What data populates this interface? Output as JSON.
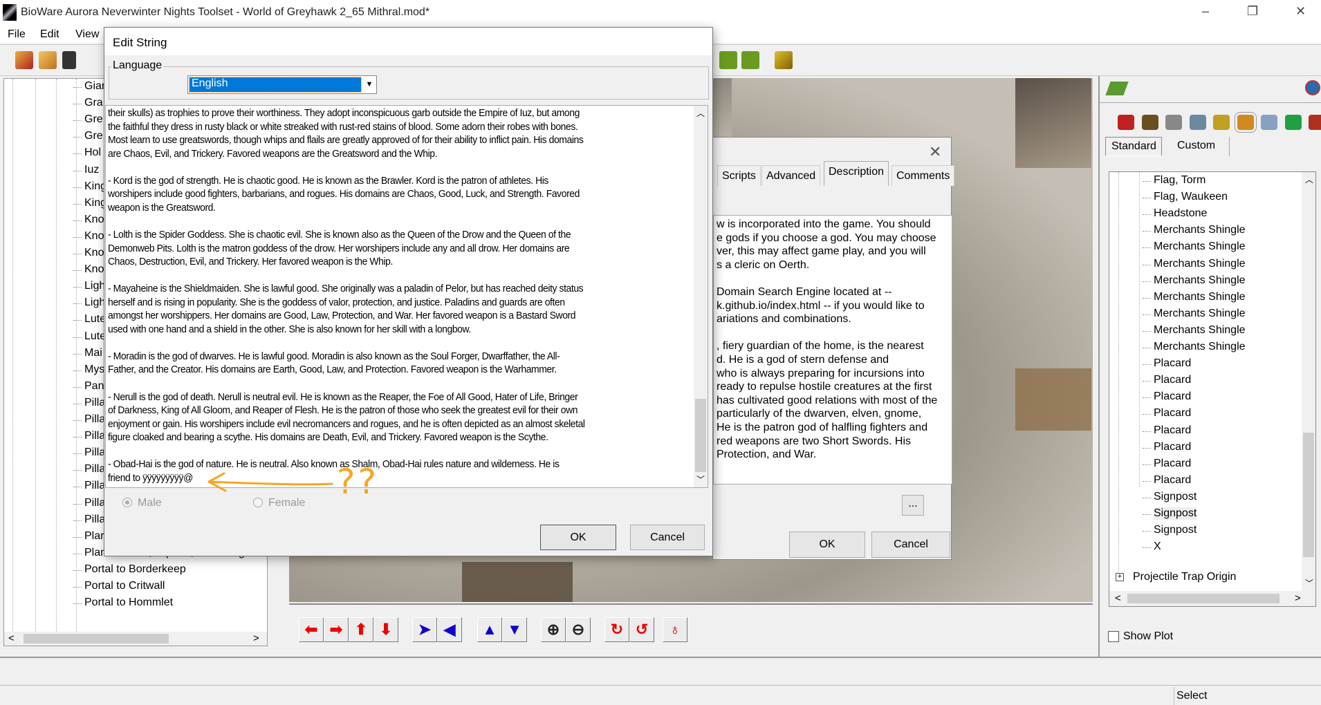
{
  "window": {
    "title": "BioWare Aurora Neverwinter Nights Toolset - World of Greyhawk 2_65 Mithral.mod*",
    "minimize": "–",
    "maximize": "❐",
    "close": "✕"
  },
  "menu": [
    "File",
    "Edit",
    "View"
  ],
  "left_tree": [
    "Giar",
    "Gra",
    "Gre",
    "Gre",
    "Hol",
    "Iuz",
    "King",
    "King",
    "Kno",
    "Kno",
    "Kno",
    "Kno",
    "Ligh",
    "Ligh",
    "Lute",
    "Lute",
    "Mai",
    "Mys",
    "Pan",
    "Pilla",
    "Pilla",
    "Pilla",
    "Pilla",
    "Pilla",
    "Pilla",
    "Pilla",
    "Pilla",
    "Plar",
    "Plant in Vase, Square, Flowering",
    "Portal to Borderkeep",
    "Portal to Critwall",
    "Portal to Hommlet"
  ],
  "nav_toolbar": {
    "icons": [
      "pan-left-icon",
      "pan-right-icon",
      "pan-up-icon",
      "pan-down-icon",
      "rotate-right-icon",
      "rotate-left-icon",
      "tilt-up-icon",
      "tilt-down-icon",
      "zoom-in-icon",
      "zoom-out-icon",
      "rotate-cw-icon",
      "rotate-ccw-icon",
      "reset-camera-icon"
    ],
    "glyphs": [
      "⬅",
      "➡",
      "⬆",
      "⬇",
      "➤",
      "◀",
      "▲",
      "▼",
      "⊕",
      "⊖",
      "↻",
      "↺",
      "♁"
    ]
  },
  "status": {
    "mode": "Select"
  },
  "right_panel": {
    "palette_tabs": [
      "Standard",
      "Custom"
    ],
    "tree": [
      "Flag, Torm",
      "Flag, Waukeen",
      "Headstone",
      "Merchants Shingle",
      "Merchants Shingle",
      "Merchants Shingle",
      "Merchants Shingle",
      "Merchants Shingle",
      "Merchants Shingle",
      "Merchants Shingle",
      "Merchants Shingle",
      "Placard",
      "Placard",
      "Placard",
      "Placard",
      "Placard",
      "Placard",
      "Placard",
      "Placard",
      "Signpost",
      "Signpost",
      "Signpost",
      "X"
    ],
    "tree_group": "Projectile Trap Origin",
    "show_plot": "Show Plot"
  },
  "properties_dialog": {
    "tabs": [
      "Scripts",
      "Advanced",
      "Description",
      "Comments"
    ],
    "active_tab": "Description",
    "close": "✕",
    "text_lines": [
      "w is incorporated into the game.  You should",
      "e gods if you choose a god.  You may choose",
      "ver, this may affect game play, and you will",
      "s a cleric on Oerth.",
      "",
      "Domain Search Engine located at --",
      "k.github.io/index.html -- if you would like to",
      "ariations and combinations.",
      "",
      ", fiery guardian of the home, is the nearest",
      "d.  He is a god of stern defense and",
      "who is always preparing for incursions into",
      "ready to repulse hostile creatures at the first",
      "has cultivated good relations with most of the",
      "particularly of the dwarven, elven, gnome,",
      "He is the patron god of halfling fighters and",
      "red weapons are two Short Swords.  His",
      "Protection, and War."
    ],
    "ellipsis_button": "...",
    "ok": "OK",
    "cancel": "Cancel"
  },
  "edit_string_dialog": {
    "title": "Edit String",
    "language_label": "Language",
    "language_value": "English",
    "text_lines": [
      "their skulls) as trophies to prove their worthiness.  They adopt inconspicuous garb outside the Empire of Iuz, but among",
      "the faithful they dress in rusty black or white streaked with rust-red stains of blood.  Some adorn their robes with bones.",
      "Most learn to use greatswords, though whips and flails are greatly approved of for their ability to inflict pain.  His domains",
      "are Chaos, Evil, and Trickery.  Favored weapons are the Greatsword and the Whip.",
      "",
      "- Kord is the god of strength.  He is chaotic good.  He is known as the Brawler.  Kord is the patron of athletes.  His",
      "worshipers include good fighters, barbarians, and rogues.  His domains are Chaos, Good, Luck, and Strength.  Favored",
      "weapon is the Greatsword.",
      "",
      "- Lolth is the Spider Goddess.  She is chaotic evil.  She is known also as the Queen of the Drow and the Queen of the",
      "Demonweb Pits.  Lolth is the matron goddess of the drow.  Her worshipers include any and all drow.  Her domains are",
      "Chaos, Destruction, Evil, and Trickery.  Her favored weapon is the Whip.",
      "",
      "- Mayaheine is the Shieldmaiden.  She is lawful good.  She originally was a paladin of Pelor, but has reached deity status",
      "herself and is rising in popularity.  She is the goddess of valor, protection, and justice.  Paladins and guards are often",
      "amongst her worshippers.  Her domains are Good, Law, Protection, and War.  Her favored weapon is a Bastard Sword",
      "used with one hand and a shield in the other.  She is also known for her skill with a longbow.",
      "",
      "- Moradin is the god of dwarves.  He is lawful good.  Moradin is also known as the Soul Forger, Dwarffather, the All-",
      "Father, and the Creator.  His domains are Earth, Good, Law, and Protection.  Favored weapon is the Warhammer.",
      "",
      "- Nerull is the god of death.  Nerull is neutral evil.  He is known as the Reaper, the Foe of All Good, Hater of Life, Bringer",
      "of Darkness, King of All Gloom, and Reaper of Flesh.  He is the patron of those who seek the greatest evil for their own",
      "enjoyment or gain.  His worshipers include evil necromancers and rogues, and he is often depicted as an almost skeletal",
      "figure cloaked and bearing a scythe.  His domains are Death, Evil, and Trickery.  Favored weapon is the Scythe.",
      "",
      "- Obad-Hai is the god of nature.  He is neutral.  Also known as Shalm, Obad-Hai rules nature and wilderness.  He is",
      "friend to ÿÿÿÿÿÿÿÿÿ@"
    ],
    "gender_options": [
      "Male",
      "Female"
    ],
    "selected_gender": "Male",
    "ok": "OK",
    "cancel": "Cancel",
    "annotation": "??",
    "annotation_color": "#f5a623"
  }
}
